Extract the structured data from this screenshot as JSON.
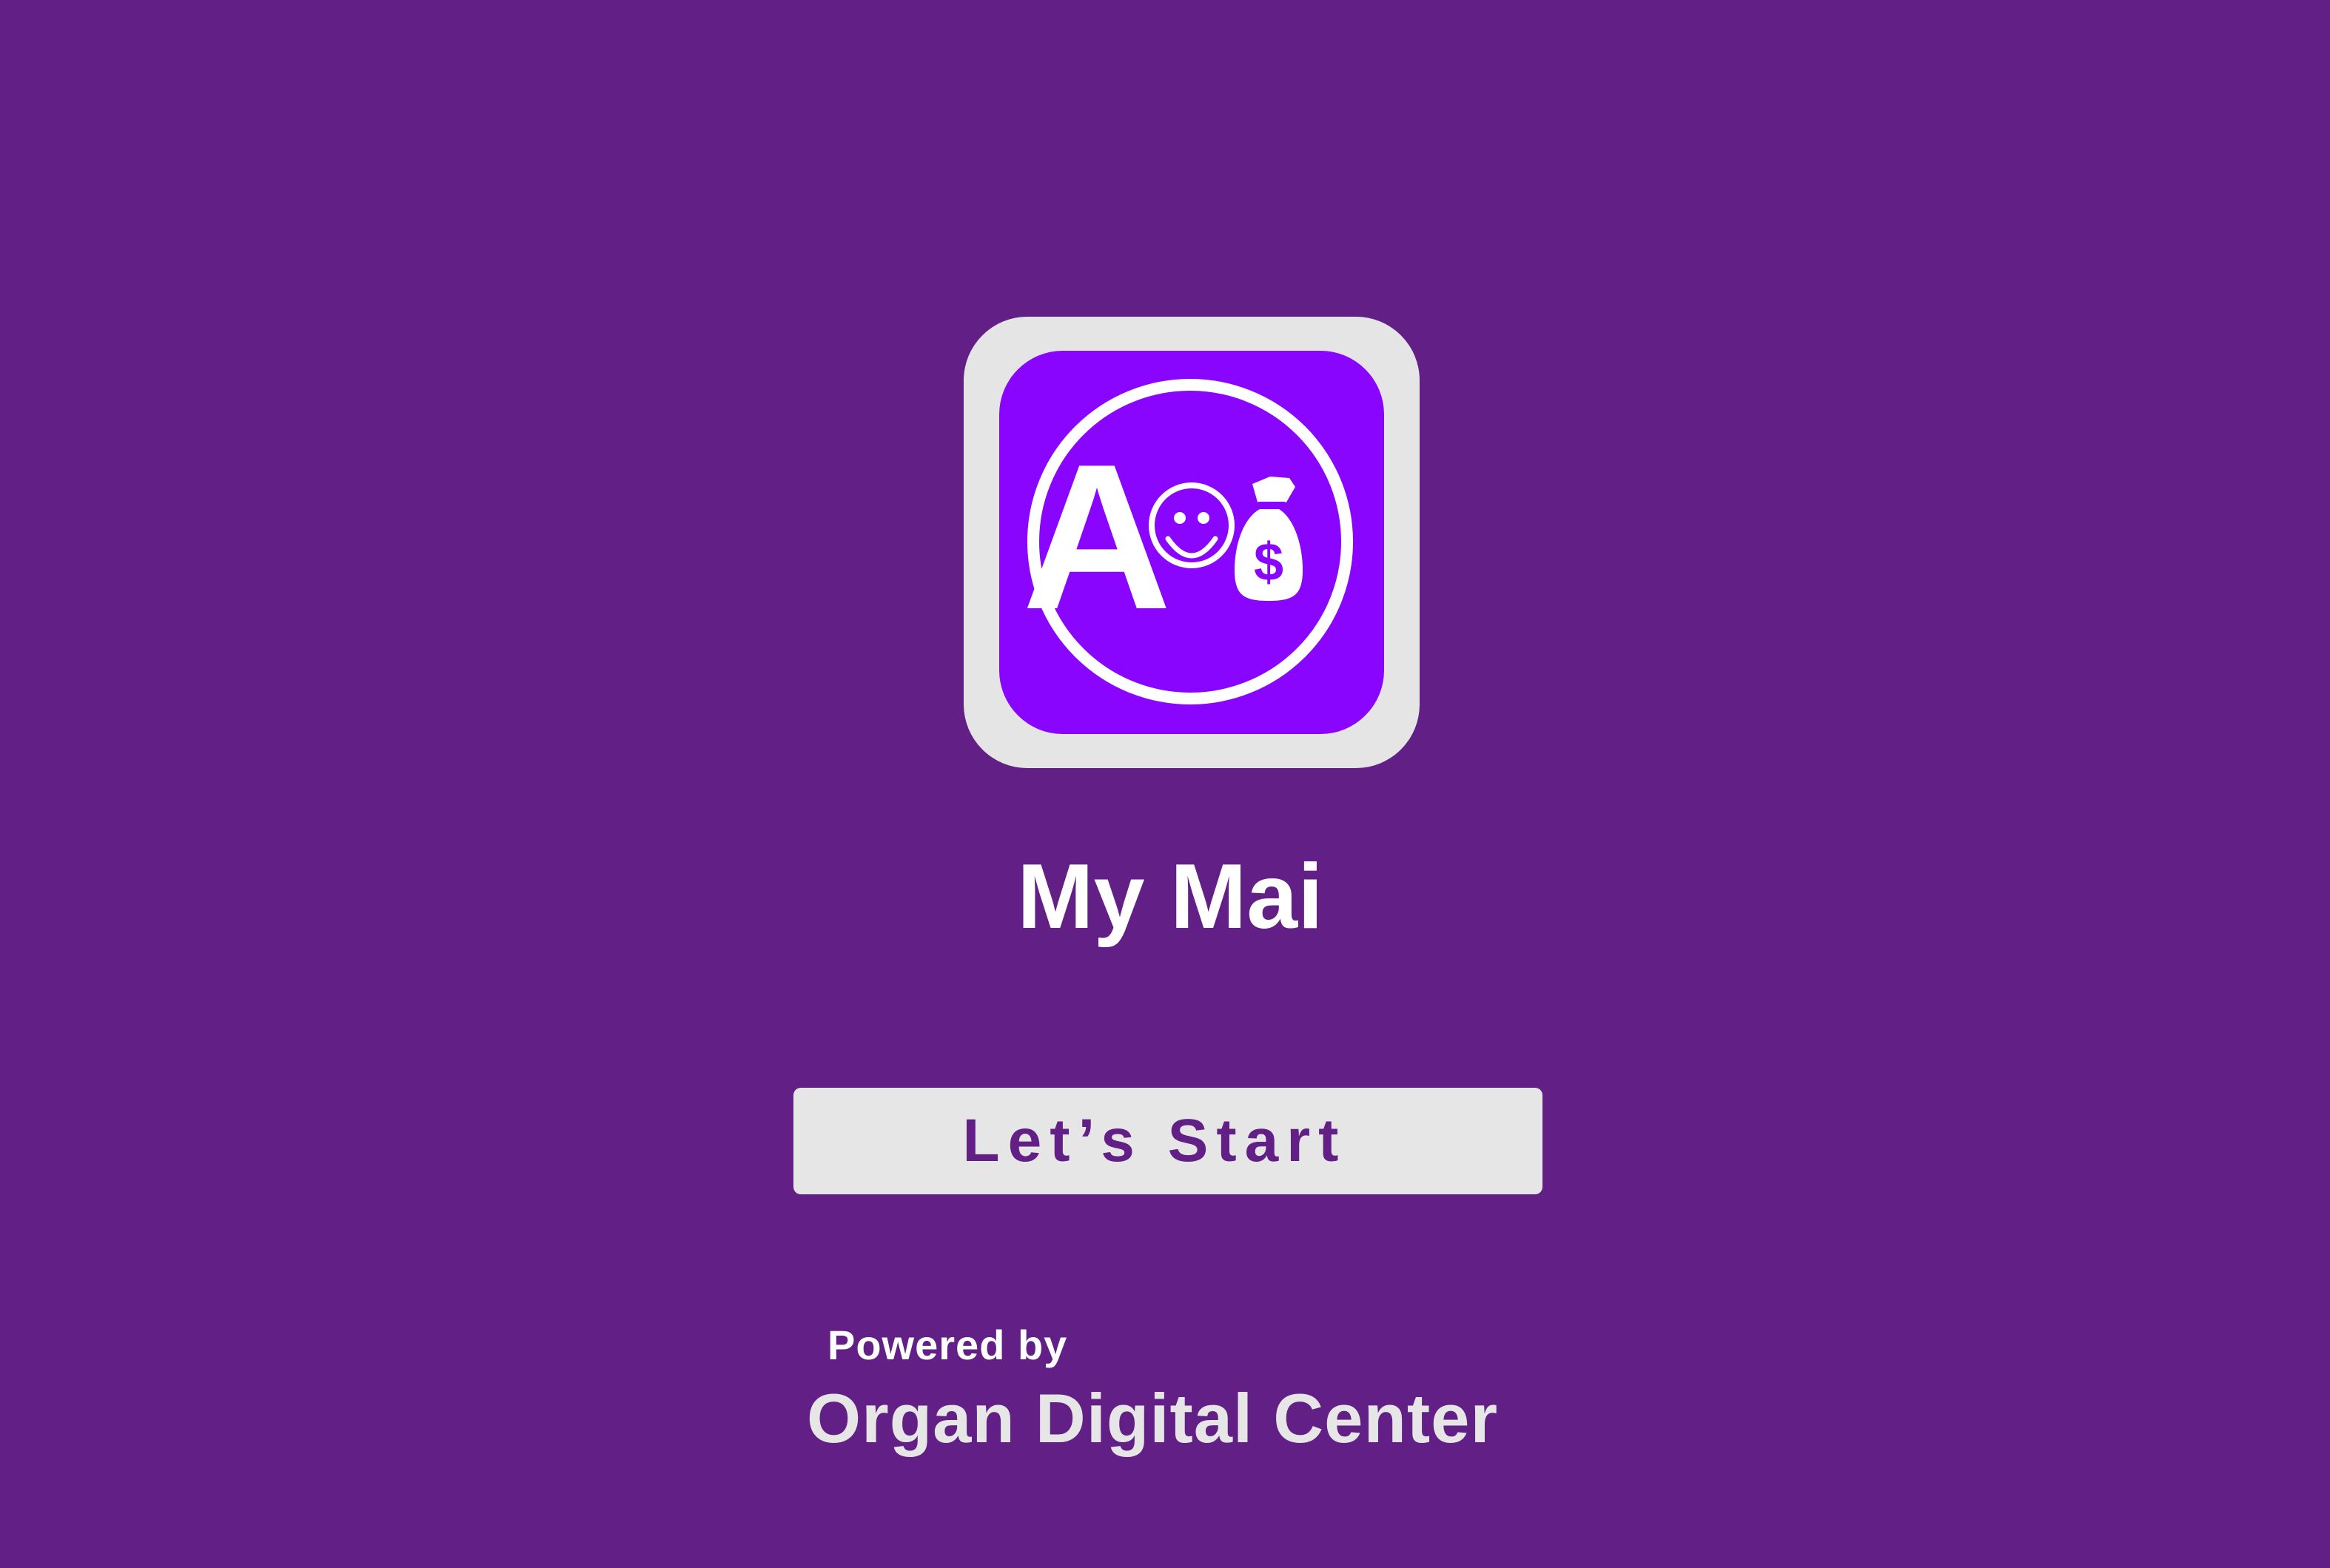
{
  "colors": {
    "background": "#621f85",
    "icon_frame": "#e5e5e5",
    "icon_fill": "#8a05fd",
    "button_background": "#e6e6e6",
    "button_text": "#621f85"
  },
  "logo": {
    "icon": "a-smiley-money-bag-logo-icon",
    "letter": "A"
  },
  "app": {
    "title": "My Mai"
  },
  "start_button": {
    "label": "Let’s Start"
  },
  "footer": {
    "powered_by": "Powered by",
    "company": "Organ Digital Center"
  }
}
